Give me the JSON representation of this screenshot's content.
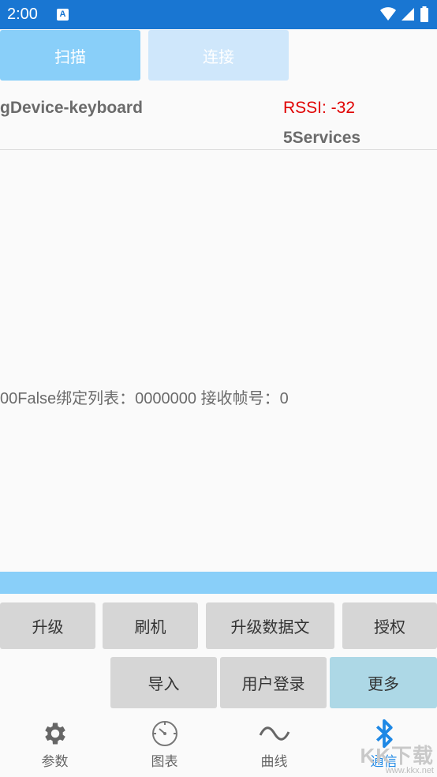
{
  "status_bar": {
    "time": "2:00",
    "notification_icon": "A"
  },
  "top_buttons": {
    "scan_label": "扫描",
    "connect_label": "连接"
  },
  "device": {
    "name": "gDevice-keyboard",
    "rssi": "RSSI: -32",
    "services": "5Services"
  },
  "status_line": "00False绑定列表：0000000  接收帧号：0",
  "actions": {
    "upgrade": "升级",
    "flash": "刷机",
    "upgrade_data": "升级数据文",
    "authorize": "授权",
    "import": "导入",
    "user_login": "用户登录",
    "more": "更多"
  },
  "nav": [
    {
      "label": "参数",
      "icon": "gear-icon"
    },
    {
      "label": "图表",
      "icon": "gauge-icon"
    },
    {
      "label": "曲线",
      "icon": "wave-icon"
    },
    {
      "label": "通信",
      "icon": "bluetooth-icon",
      "active": true
    }
  ],
  "watermark": {
    "big": "KK下载",
    "small": "www.kkx.net"
  },
  "colors": {
    "status_bar": "#1976d2",
    "accent_light_blue": "#89cff9",
    "rssi_red": "#e00000",
    "active_nav": "#1e88e5",
    "more_button": "#add8e6"
  }
}
